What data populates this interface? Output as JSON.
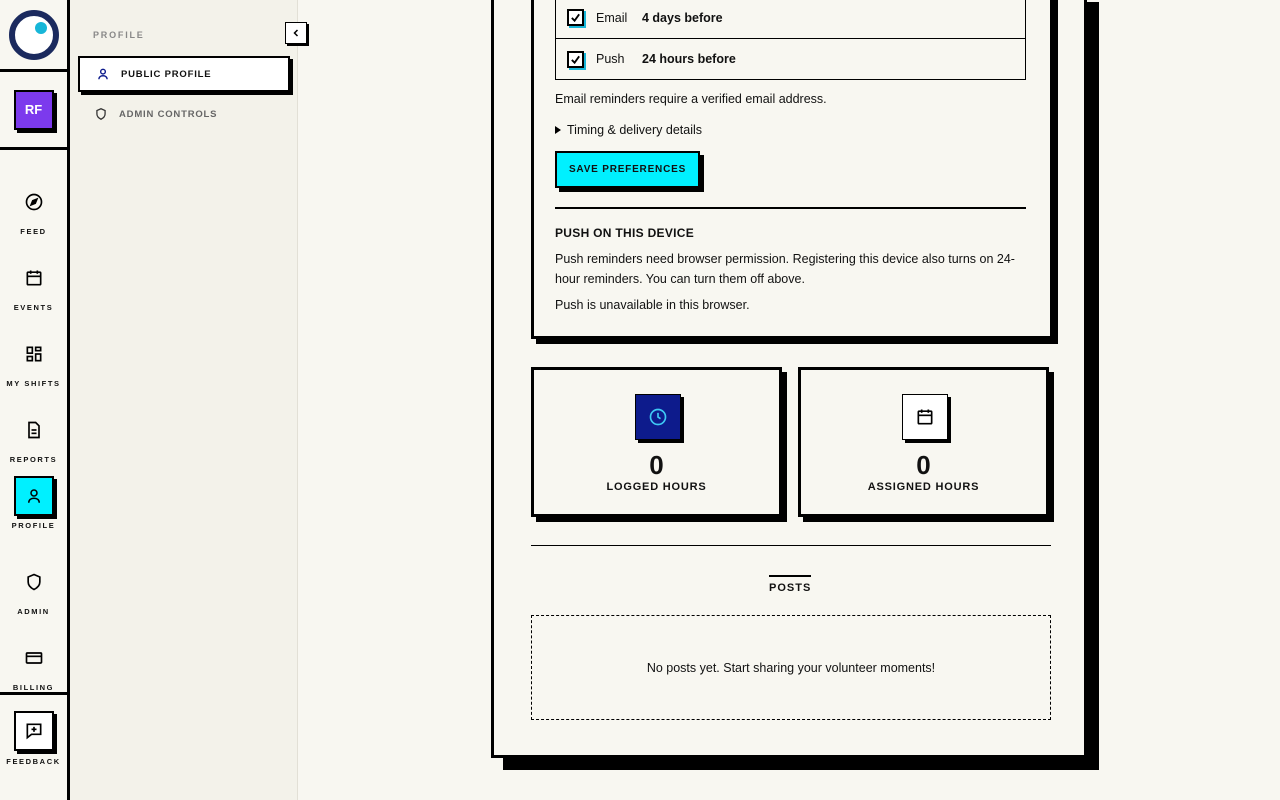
{
  "rail": {
    "avatar_initials": "RF",
    "items": [
      {
        "label": "FEED",
        "icon": "compass-icon"
      },
      {
        "label": "EVENTS",
        "icon": "calendar-icon"
      },
      {
        "label": "MY SHIFTS",
        "icon": "grid-icon"
      },
      {
        "label": "REPORTS",
        "icon": "document-icon"
      },
      {
        "label": "PROFILE",
        "icon": "user-icon",
        "active": true
      },
      {
        "label": "ADMIN",
        "icon": "shield-icon"
      },
      {
        "label": "BILLING",
        "icon": "card-icon"
      }
    ],
    "feedback_label": "FEEDBACK"
  },
  "subnav": {
    "title": "PROFILE",
    "items": [
      {
        "label": "PUBLIC PROFILE",
        "icon": "user-icon",
        "active": true
      },
      {
        "label": "ADMIN CONTROLS",
        "icon": "shield-icon"
      }
    ]
  },
  "reminders": {
    "rows": [
      {
        "channel": "Email",
        "value": "4 days before",
        "checked": true
      },
      {
        "channel": "Push",
        "value": "24 hours before",
        "checked": true
      }
    ],
    "email_note": "Email reminders require a verified email address.",
    "details_label": "Timing & delivery details",
    "save_label": "SAVE PREFERENCES"
  },
  "push_device": {
    "title": "PUSH ON THIS DEVICE",
    "description": "Push reminders need browser permission. Registering this device also turns on 24-hour reminders. You can turn them off above.",
    "status": "Push is unavailable in this browser."
  },
  "stats": [
    {
      "value": "0",
      "label": "LOGGED HOURS",
      "icon": "clock-icon"
    },
    {
      "value": "0",
      "label": "ASSIGNED HOURS",
      "icon": "calendar-icon"
    }
  ],
  "posts": {
    "tab_label": "POSTS",
    "empty_text": "No posts yet. Start sharing your volunteer moments!"
  },
  "colors": {
    "accent": "#00f0ff",
    "avatar": "#7c3aed",
    "navy": "#0d1b8c",
    "logo_ring": "#1b2a5e",
    "logo_dot": "#17b6d8",
    "background": "#f8f7f1"
  }
}
